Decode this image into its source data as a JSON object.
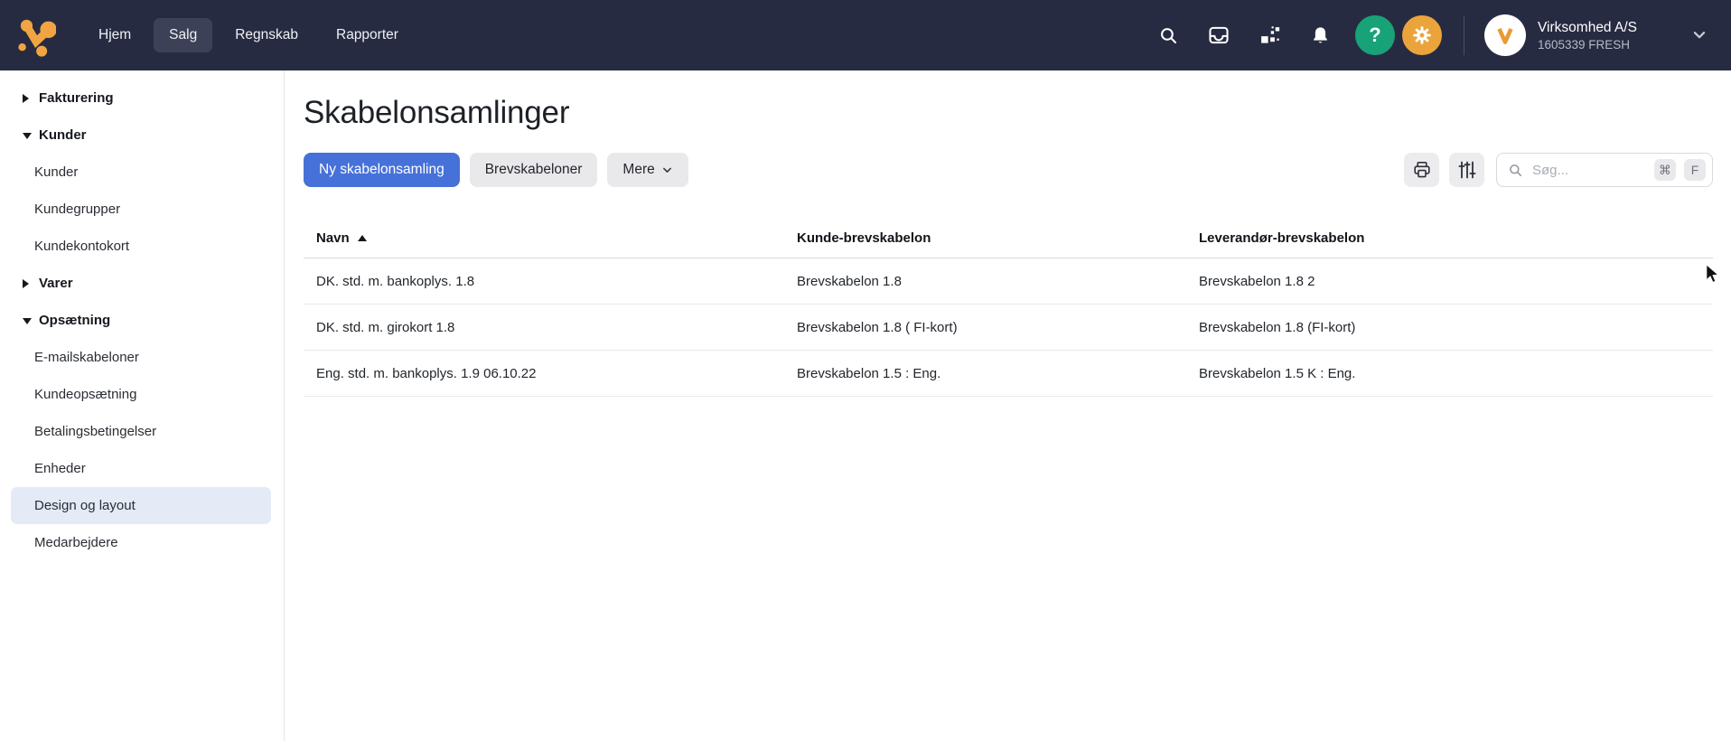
{
  "topbar": {
    "nav": [
      {
        "label": "Hjem"
      },
      {
        "label": "Salg",
        "active": true
      },
      {
        "label": "Regnskab"
      },
      {
        "label": "Rapporter"
      }
    ],
    "company": {
      "name": "Virksomhed A/S",
      "subtitle": "1605339 FRESH"
    }
  },
  "sidebar": {
    "items": [
      {
        "label": "Fakturering",
        "type": "section",
        "expanded": false
      },
      {
        "label": "Kunder",
        "type": "section",
        "expanded": true
      },
      {
        "label": "Kunder",
        "type": "link"
      },
      {
        "label": "Kundegrupper",
        "type": "link"
      },
      {
        "label": "Kundekontokort",
        "type": "link"
      },
      {
        "label": "Varer",
        "type": "section",
        "expanded": false
      },
      {
        "label": "Opsætning",
        "type": "section",
        "expanded": true
      },
      {
        "label": "E-mailskabeloner",
        "type": "link"
      },
      {
        "label": "Kundeopsætning",
        "type": "link"
      },
      {
        "label": "Betalingsbetingelser",
        "type": "link"
      },
      {
        "label": "Enheder",
        "type": "link"
      },
      {
        "label": "Design og layout",
        "type": "link",
        "active": true
      },
      {
        "label": "Medarbejdere",
        "type": "link"
      }
    ]
  },
  "main": {
    "title": "Skabelonsamlinger",
    "toolbar": {
      "new_button": "Ny skabelonsamling",
      "letter_templates_button": "Brevskabeloner",
      "more_button": "Mere",
      "search_placeholder": "Søg...",
      "shortcut_keys": [
        "⌘",
        "F"
      ]
    },
    "table": {
      "columns": [
        "Navn",
        "Kunde-brevskabelon",
        "Leverandør-brevskabelon"
      ],
      "sort": {
        "column": "Navn",
        "direction": "ascending"
      },
      "rows": [
        [
          "DK. std. m. bankoplys. 1.8",
          "Brevskabelon 1.8",
          "Brevskabelon 1.8 2"
        ],
        [
          "DK. std. m. girokort 1.8",
          "Brevskabelon 1.8 ( FI-kort)",
          "Brevskabelon 1.8 (FI-kort)"
        ],
        [
          "Eng. std. m. bankoplys. 1.9 06.10.22",
          "Brevskabelon 1.5 : Eng.",
          "Brevskabelon 1.5 K : Eng."
        ]
      ]
    }
  },
  "colors": {
    "topbar_bg": "#272b42",
    "primary_blue": "#4671d8",
    "brand_orange": "#f0a542",
    "help_green": "#17a377",
    "settings_orange": "#eba43c",
    "active_sidebar_bg": "#e4eaf6"
  }
}
